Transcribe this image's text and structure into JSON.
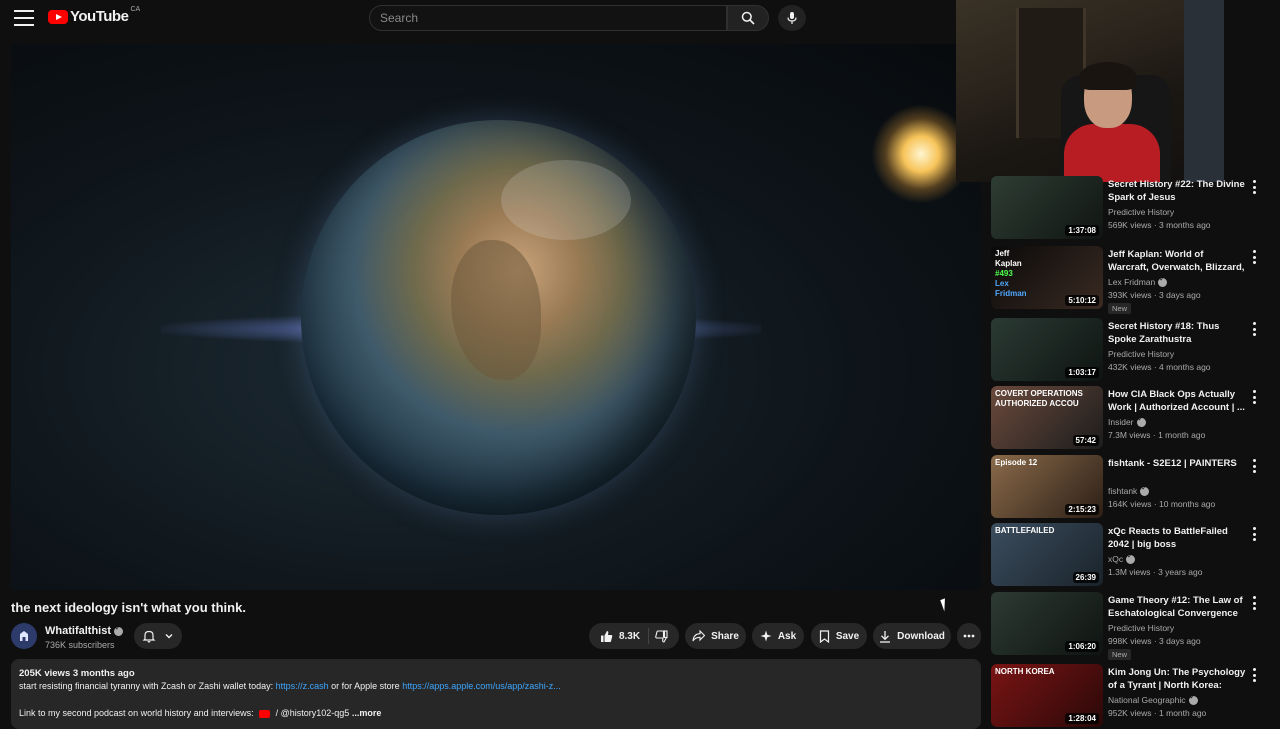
{
  "header": {
    "logo_text": "YouTube",
    "country": "CA",
    "search_placeholder": "Search"
  },
  "video": {
    "title": "the next ideology isn't what you think.",
    "channel": "Whatifalthist",
    "subscribers": "736K subscribers",
    "likes": "8.3K",
    "actions": {
      "share": "Share",
      "ask": "Ask",
      "save": "Save",
      "download": "Download"
    }
  },
  "description": {
    "meta": "205K views  3 months ago",
    "line1_text": "start resisting financial tyranny with Zcash or Zashi wallet today: ",
    "line1_link1": "https://z.cash",
    "line1_mid": " or for Apple store ",
    "line1_link2": "https://apps.apple.com/us/app/zashi-z...",
    "line2_text": "Link to my second podcast on world history and interviews: ",
    "line2_handle": " / @history102-qg5",
    "more": "...more"
  },
  "recommendations": [
    {
      "title": "Secret History #22: The Divine Spark of Jesus",
      "channel": "Predictive History",
      "verified": false,
      "views": "569K views · 3 months ago",
      "duration": "1:37:08",
      "badge": "",
      "thumb_colors": [
        "#2e3d34",
        "#101512"
      ]
    },
    {
      "title": "Jeff Kaplan: World of Warcraft, Overwatch, Blizzard, and Futur...",
      "channel": "Lex Fridman",
      "verified": true,
      "views": "393K views · 3 days ago",
      "duration": "5:10:12",
      "badge": "New",
      "thumb_text": [
        "Jeff",
        "Kaplan",
        "#493",
        "Lex",
        "Fridman"
      ],
      "thumb_colors": [
        "#0a0a0a",
        "#3a2a22"
      ]
    },
    {
      "title": "Secret History #18: Thus Spoke Zarathustra",
      "channel": "Predictive History",
      "verified": false,
      "views": "432K views · 4 months ago",
      "duration": "1:03:17",
      "badge": "",
      "thumb_colors": [
        "#2b3a34",
        "#0e1411"
      ]
    },
    {
      "title": "How CIA Black Ops Actually Work | Authorized Account | ...",
      "channel": "Insider",
      "verified": true,
      "views": "7.3M views · 1 month ago",
      "duration": "57:42",
      "badge": "",
      "thumb_text": [
        "COVERT OPERATIONS",
        "AUTHORIZED ACCOU"
      ],
      "thumb_colors": [
        "#6b4a3c",
        "#1c1c1c"
      ]
    },
    {
      "title": "fishtank - S2E12 | PAINTERS",
      "channel": "fishtank",
      "verified": true,
      "views": "164K views · 10 months ago",
      "duration": "2:15:23",
      "badge": "",
      "thumb_text": [
        "Episode 12"
      ],
      "thumb_colors": [
        "#8a6a4a",
        "#2c1f16"
      ]
    },
    {
      "title": "xQc Reacts to BattleFailed 2042 | big boss",
      "channel": "xQc",
      "verified": true,
      "views": "1.3M views · 3 years ago",
      "duration": "26:39",
      "badge": "",
      "thumb_text": [
        "BATTLEFAILED"
      ],
      "thumb_colors": [
        "#3b4d5e",
        "#1a232b"
      ]
    },
    {
      "title": "Game Theory #12: The Law of Eschatological Convergence",
      "channel": "Predictive History",
      "verified": false,
      "views": "998K views · 3 days ago",
      "duration": "1:06:20",
      "badge": "New",
      "thumb_colors": [
        "#2d3a33",
        "#0f1411"
      ]
    },
    {
      "title": "Kim Jong Un: The Psychology of a Tyrant | North Korea: Insid...",
      "channel": "National Geographic",
      "verified": true,
      "views": "952K views · 1 month ago",
      "duration": "1:28:04",
      "badge": "",
      "thumb_text": [
        "NORTH KOREA"
      ],
      "thumb_colors": [
        "#7a1414",
        "#2a0808"
      ]
    }
  ]
}
